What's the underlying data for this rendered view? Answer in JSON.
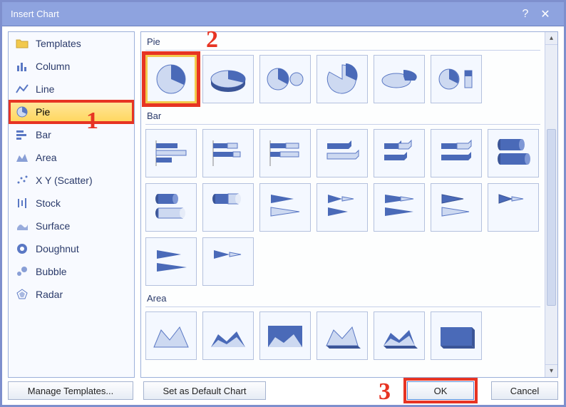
{
  "titlebar": {
    "title": "Insert Chart",
    "help": "?",
    "close": "✕"
  },
  "sidebar": {
    "items": [
      {
        "label": "Templates",
        "icon": "templates"
      },
      {
        "label": "Column",
        "icon": "column"
      },
      {
        "label": "Line",
        "icon": "line"
      },
      {
        "label": "Pie",
        "icon": "pie",
        "selected": true,
        "callout": "1"
      },
      {
        "label": "Bar",
        "icon": "bar"
      },
      {
        "label": "Area",
        "icon": "area"
      },
      {
        "label": "X Y (Scatter)",
        "icon": "scatter"
      },
      {
        "label": "Stock",
        "icon": "stock"
      },
      {
        "label": "Surface",
        "icon": "surface"
      },
      {
        "label": "Doughnut",
        "icon": "doughnut"
      },
      {
        "label": "Bubble",
        "icon": "bubble"
      },
      {
        "label": "Radar",
        "icon": "radar"
      }
    ]
  },
  "groups": [
    {
      "label": "Pie",
      "callout": "2",
      "thumbs": [
        "pie-2d",
        "pie-3d",
        "pie-of-pie",
        "pie-exploded",
        "pie-exploded-3d",
        "bar-of-pie"
      ],
      "selected_index": 0
    },
    {
      "label": "Bar",
      "thumbs": [
        "bar-clustered",
        "bar-stacked",
        "bar-100",
        "bar-3d-clustered",
        "bar-3d-stacked",
        "bar-3d-100",
        "cyl-clustered",
        "cyl-horiz-clustered",
        "cyl-horiz-stacked",
        "cone-clustered",
        "cone-stacked",
        "cone-100",
        "pyr-clustered",
        "pyr-stacked",
        "cone-horiz",
        "cone-horiz-stacked"
      ]
    },
    {
      "label": "Area",
      "thumbs": [
        "area-2d",
        "area-stacked",
        "area-100",
        "area-3d",
        "area-3d-stacked",
        "area-3d-solid"
      ]
    }
  ],
  "buttons": {
    "manage_templates": "Manage Templates...",
    "set_default": "Set as Default Chart",
    "ok": "OK",
    "cancel": "Cancel",
    "ok_callout": "3"
  },
  "colors": {
    "accent": "#5a78c4",
    "accent_dark": "#3b5597",
    "fill_light": "#cdd9f1"
  }
}
